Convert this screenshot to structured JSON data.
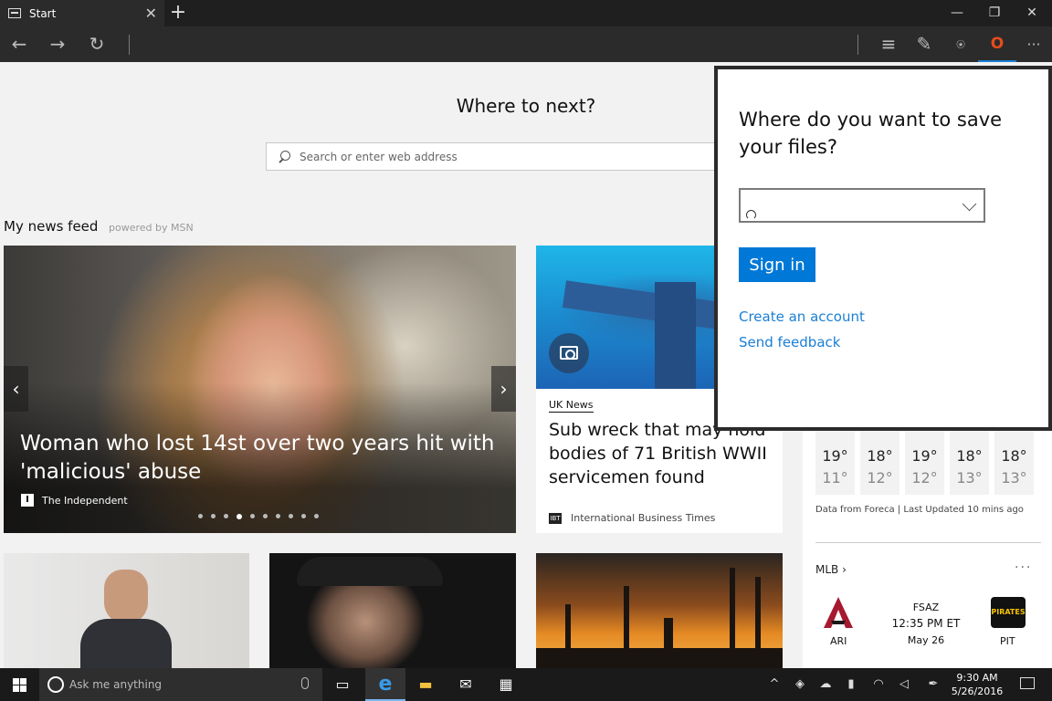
{
  "browser": {
    "tab_title": "Start",
    "tab_close": "✕",
    "new_tab": "+",
    "window_buttons": [
      "—",
      "❐",
      "✕"
    ]
  },
  "nav": {
    "back": "←",
    "forward": "→",
    "refresh": "↻",
    "hub": "≡",
    "note": "✎",
    "share": "⍟",
    "office": "O",
    "more": "···"
  },
  "start": {
    "heading": "Where to next?",
    "search_placeholder": "Search or enter web address"
  },
  "feed": {
    "title": "My news feed",
    "powered_by": "powered by MSN"
  },
  "carousel": {
    "headline": "Woman who lost 14st over two years hit with 'malicious' abuse",
    "source_logo": "I",
    "source": "The Independent",
    "prev": "‹",
    "next": "›",
    "dot_count": 10,
    "active_dot": 4
  },
  "story2": {
    "category": "UK News",
    "headline": "Sub wreck that may hold bodies of 71 British WWII servicemen found",
    "source_logo": "IBT",
    "source": "International Business Times"
  },
  "weather": {
    "days": [
      {
        "hi": "19°",
        "lo": "11°"
      },
      {
        "hi": "18°",
        "lo": "12°"
      },
      {
        "hi": "19°",
        "lo": "12°"
      },
      {
        "hi": "18°",
        "lo": "13°"
      },
      {
        "hi": "18°",
        "lo": "13°"
      }
    ],
    "footer": "Data from Foreca | Last Updated 10 mins ago"
  },
  "mlb": {
    "title": "MLB ›",
    "more": "···",
    "away": "ARI",
    "home": "PIT",
    "home_logo": "PIRATES",
    "network": "FSAZ",
    "time": "12:35 PM ET",
    "date": "May 26"
  },
  "popup": {
    "title": "Where do you want to save your files?",
    "sign_in": "Sign in",
    "create_account": "Create an account",
    "send_feedback": "Send feedback"
  },
  "taskbar": {
    "search_placeholder": "Ask me anything",
    "task_view": "▭",
    "edge": "e",
    "explorer": "▬",
    "mail": "✉",
    "store": "▦",
    "tray_up": "^",
    "shield": "◈",
    "cloud": "☁",
    "battery": "▮",
    "wifi": "◠",
    "volume": "◁",
    "pen": "✒",
    "time": "9:30 AM",
    "date": "5/26/2016"
  },
  "colors": {
    "accent": "#0078d7",
    "link": "#1a7fd4",
    "office": "#e74c1c"
  }
}
